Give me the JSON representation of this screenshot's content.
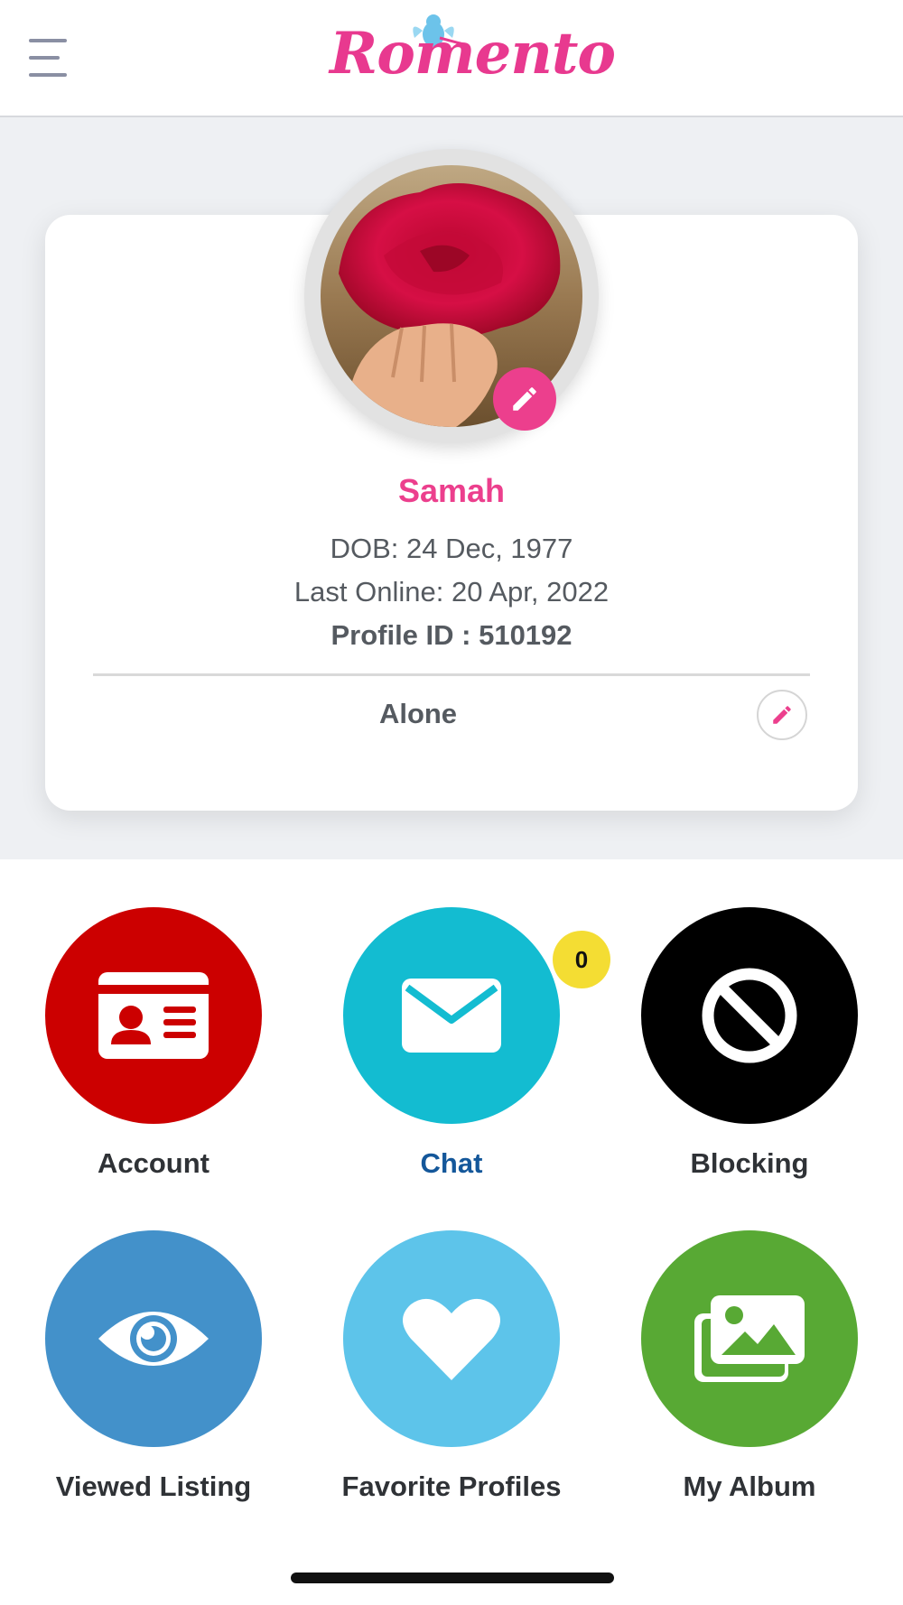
{
  "header": {
    "logo_text": "Romento",
    "menu_icon": "hamburger-menu-icon"
  },
  "profile": {
    "name": "Samah",
    "dob": "DOB: 24 Dec, 1977",
    "last_online": "Last Online: 20 Apr, 2022",
    "profile_id": "Profile ID : 510192",
    "status": "Alone"
  },
  "tiles": [
    {
      "label": "Account",
      "icon": "id-card-icon",
      "color": "#cc0000",
      "label_color": "#2f3236"
    },
    {
      "label": "Chat",
      "icon": "envelope-icon",
      "color": "#13bcd1",
      "label_color": "#14579a",
      "badge": "0"
    },
    {
      "label": "Blocking",
      "icon": "block-icon",
      "color": "#000000",
      "label_color": "#2f3236"
    },
    {
      "label": "Viewed Listing",
      "icon": "eye-icon",
      "color": "#4391ca",
      "label_color": "#2f3236"
    },
    {
      "label": "Favorite Profiles",
      "icon": "heart-icon",
      "color": "#5dc4ea",
      "label_color": "#2f3236"
    },
    {
      "label": "My Album",
      "icon": "images-icon",
      "color": "#58a934",
      "label_color": "#2f3236"
    }
  ],
  "colors": {
    "brand_pink": "#ec3f8d",
    "background_gray": "#eef0f3"
  }
}
